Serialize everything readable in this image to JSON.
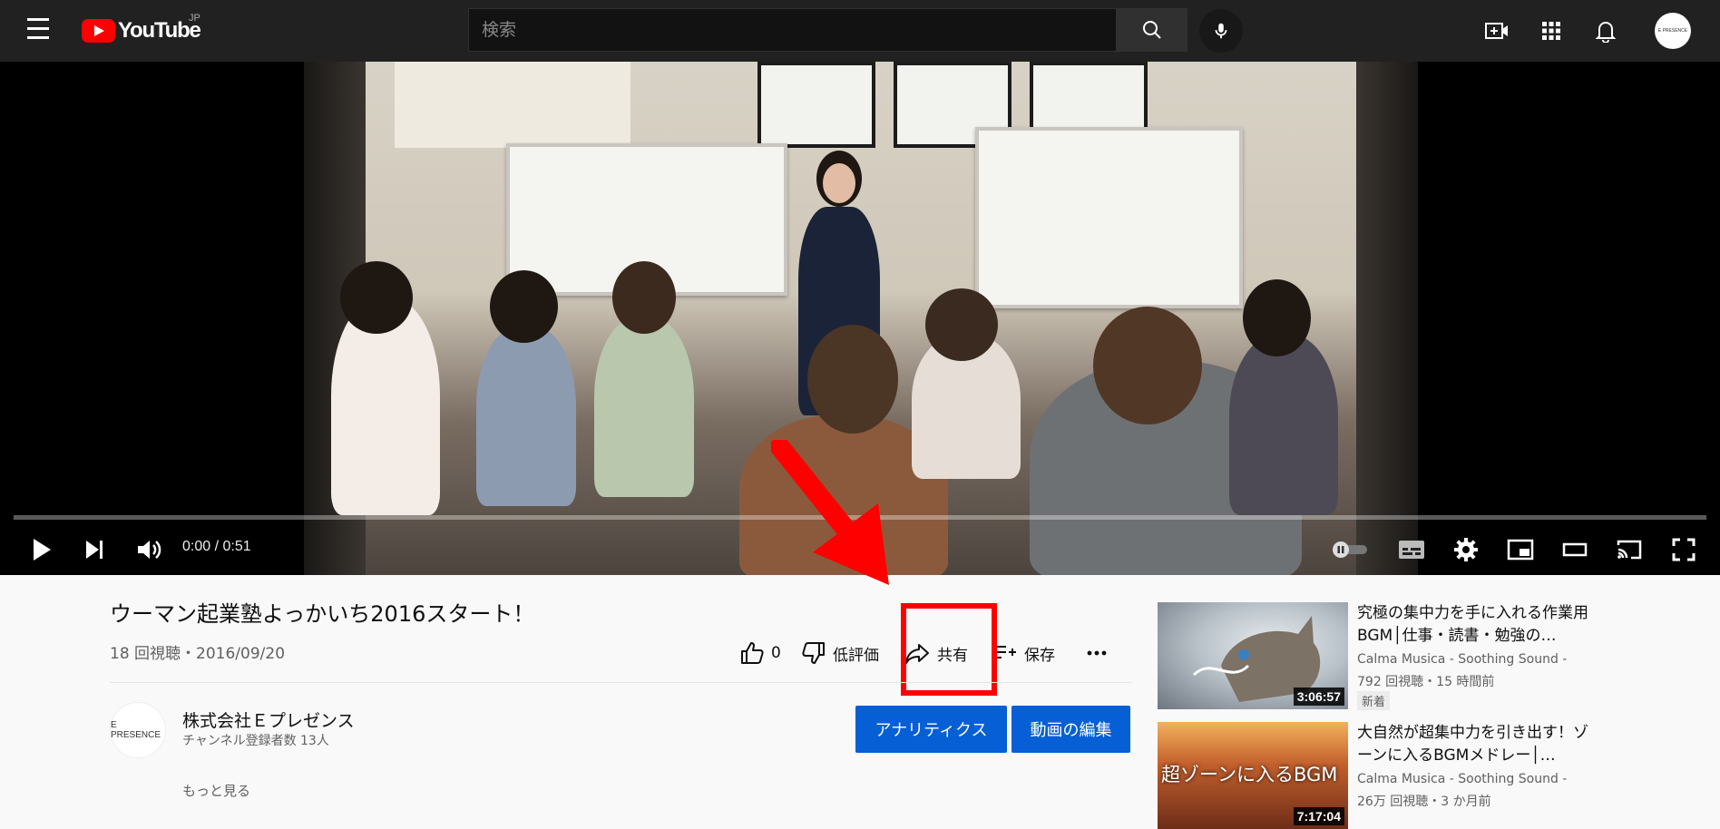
{
  "header": {
    "logo_text": "YouTube",
    "region": "JP",
    "search_placeholder": "検索",
    "avatar_text": "E PRESENCE"
  },
  "player": {
    "time_display": "0:00 / 0:51",
    "progress_fraction": 0.0
  },
  "video": {
    "title": "ウーマン起業塾よっかいち2016スタート！",
    "meta": "18 回視聴・2016/09/20",
    "likes": "0",
    "dislike_label": "低評価",
    "share_label": "共有",
    "save_label": "保存"
  },
  "owner": {
    "avatar_text": "E PRESENCE",
    "name": "株式会社Ｅプレゼンス",
    "subscribers": "チャンネル登録者数 13人",
    "analytics_label": "アナリティクス",
    "edit_label": "動画の編集",
    "show_more": "もっと見る"
  },
  "recommendations": [
    {
      "title": "究極の集中力を手に入れる作業用BGM│仕事・読書・勉強の…",
      "channel": "Calma Musica - Soothing Sound -",
      "stats": "792 回視聴・15 時間前",
      "badge": "新着",
      "duration": "3:06:57"
    },
    {
      "title": "大自然が超集中力を引き出す！ゾーンに入るBGMメドレー│…",
      "channel": "Calma Musica - Soothing Sound -",
      "stats": "26万 回視聴・3 か月前",
      "thumb_text": "超ゾーンに入るBGM",
      "duration": "7:17:04"
    }
  ],
  "colors": {
    "topbar": "#212121",
    "accent_red": "#ff0000",
    "button_blue": "#065fd4"
  }
}
